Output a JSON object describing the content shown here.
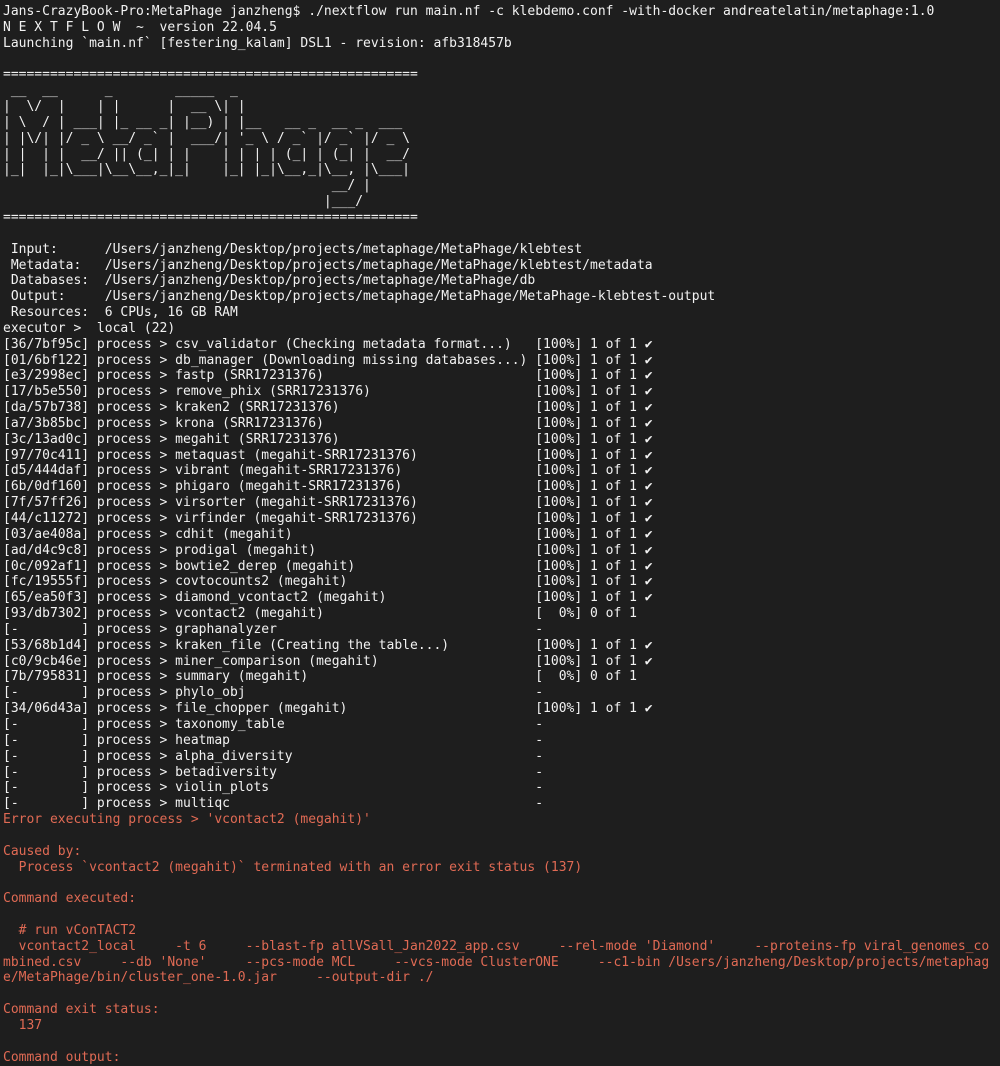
{
  "prompt": "Jans-CrazyBook-Pro:MetaPhage janzheng$ ./nextflow run main.nf -c klebdemo.conf -with-docker andreatelatin/metaphage:1.0",
  "nextflow_banner": "N E X T F L O W  ~  version 22.04.5",
  "launch_line": "Launching `main.nf` [festering_kalam] DSL1 - revision: afb318457b",
  "blank": "",
  "rule": "=====================================================",
  "ascii_art": [
    " __  __      _        _____  _",
    "|  \\/  |    | |      |  __ \\| |",
    "| \\  / | ___| |_ __ _| |__) | |__   __ _  __ _  ___",
    "| |\\/| |/ _ \\ __/ _` |  ___/| '_ \\ / _` |/ _` |/ _ \\",
    "| |  | |  __/ || (_| | |    | | | | (_| | (_| |  __/",
    "|_|  |_|\\___|\\__\\__,_|_|    |_| |_|\\__,_|\\__, |\\___|",
    "                                          __/ |",
    "                                         |___/"
  ],
  "params": [
    {
      "key": " Input:      ",
      "value": "/Users/janzheng/Desktop/projects/metaphage/MetaPhage/klebtest"
    },
    {
      "key": " Metadata:   ",
      "value": "/Users/janzheng/Desktop/projects/metaphage/MetaPhage/klebtest/metadata"
    },
    {
      "key": " Databases:  ",
      "value": "/Users/janzheng/Desktop/projects/metaphage/MetaPhage/db"
    },
    {
      "key": " Output:     ",
      "value": "/Users/janzheng/Desktop/projects/metaphage/MetaPhage/MetaPhage-klebtest-output"
    },
    {
      "key": " Resources:  ",
      "value": "6 CPUs, 16 GB RAM"
    }
  ],
  "executor_line": "executor >  local (22)",
  "processes": [
    "[36/7bf95c] process > csv_validator (Checking metadata format...)   [100%] 1 of 1 ✔",
    "[01/6bf122] process > db_manager (Downloading missing databases...) [100%] 1 of 1 ✔",
    "[e3/2998ec] process > fastp (SRR17231376)                           [100%] 1 of 1 ✔",
    "[17/b5e550] process > remove_phix (SRR17231376)                     [100%] 1 of 1 ✔",
    "[da/57b738] process > kraken2 (SRR17231376)                         [100%] 1 of 1 ✔",
    "[a7/3b85bc] process > krona (SRR17231376)                           [100%] 1 of 1 ✔",
    "[3c/13ad0c] process > megahit (SRR17231376)                         [100%] 1 of 1 ✔",
    "[97/70c411] process > metaquast (megahit-SRR17231376)               [100%] 1 of 1 ✔",
    "[d5/444daf] process > vibrant (megahit-SRR17231376)                 [100%] 1 of 1 ✔",
    "[6b/0df160] process > phigaro (megahit-SRR17231376)                 [100%] 1 of 1 ✔",
    "[7f/57ff26] process > virsorter (megahit-SRR17231376)               [100%] 1 of 1 ✔",
    "[44/c11272] process > virfinder (megahit-SRR17231376)               [100%] 1 of 1 ✔",
    "[03/ae408a] process > cdhit (megahit)                               [100%] 1 of 1 ✔",
    "[ad/d4c9c8] process > prodigal (megahit)                            [100%] 1 of 1 ✔",
    "[0c/092af1] process > bowtie2_derep (megahit)                       [100%] 1 of 1 ✔",
    "[fc/19555f] process > covtocounts2 (megahit)                        [100%] 1 of 1 ✔",
    "[65/ea50f3] process > diamond_vcontact2 (megahit)                   [100%] 1 of 1 ✔",
    "[93/db7302] process > vcontact2 (megahit)                           [  0%] 0 of 1",
    "[-        ] process > graphanalyzer                                 -",
    "[53/68b1d4] process > kraken_file (Creating the table...)           [100%] 1 of 1 ✔",
    "[c0/9cb46e] process > miner_comparison (megahit)                    [100%] 1 of 1 ✔",
    "[7b/795831] process > summary (megahit)                             [  0%] 0 of 1",
    "[-        ] process > phylo_obj                                     -",
    "[34/06d43a] process > file_chopper (megahit)                        [100%] 1 of 1 ✔",
    "[-        ] process > taxonomy_table                                -",
    "[-        ] process > heatmap                                       -",
    "[-        ] process > alpha_diversity                               -",
    "[-        ] process > betadiversity                                 -",
    "[-        ] process > violin_plots                                  -",
    "[-        ] process > multiqc                                       -"
  ],
  "error": {
    "header": "Error executing process > 'vcontact2 (megahit)'",
    "caused_by_label": "Caused by:",
    "caused_by_text": "  Process `vcontact2 (megahit)` terminated with an error exit status (137)",
    "command_executed_label": "Command executed:",
    "command_comment": "  # run vConTACT2",
    "command_lines": [
      "  vcontact2_local     -t 6     --blast-fp allVSall_Jan2022_app.csv     --rel-mode 'Diamond'     --proteins-fp viral_genomes_co",
      "mbined.csv     --db 'None'     --pcs-mode MCL     --vcs-mode ClusterONE     --c1-bin /Users/janzheng/Desktop/projects/metaphag",
      "e/MetaPhage/bin/cluster_one-1.0.jar     --output-dir ./"
    ],
    "exit_status_label": "Command exit status:",
    "exit_status_value": "  137",
    "command_output_label": "Command output:"
  },
  "colors": {
    "background": "#1e1e1e",
    "foreground": "#f2f2f2",
    "error": "#e06a54"
  }
}
